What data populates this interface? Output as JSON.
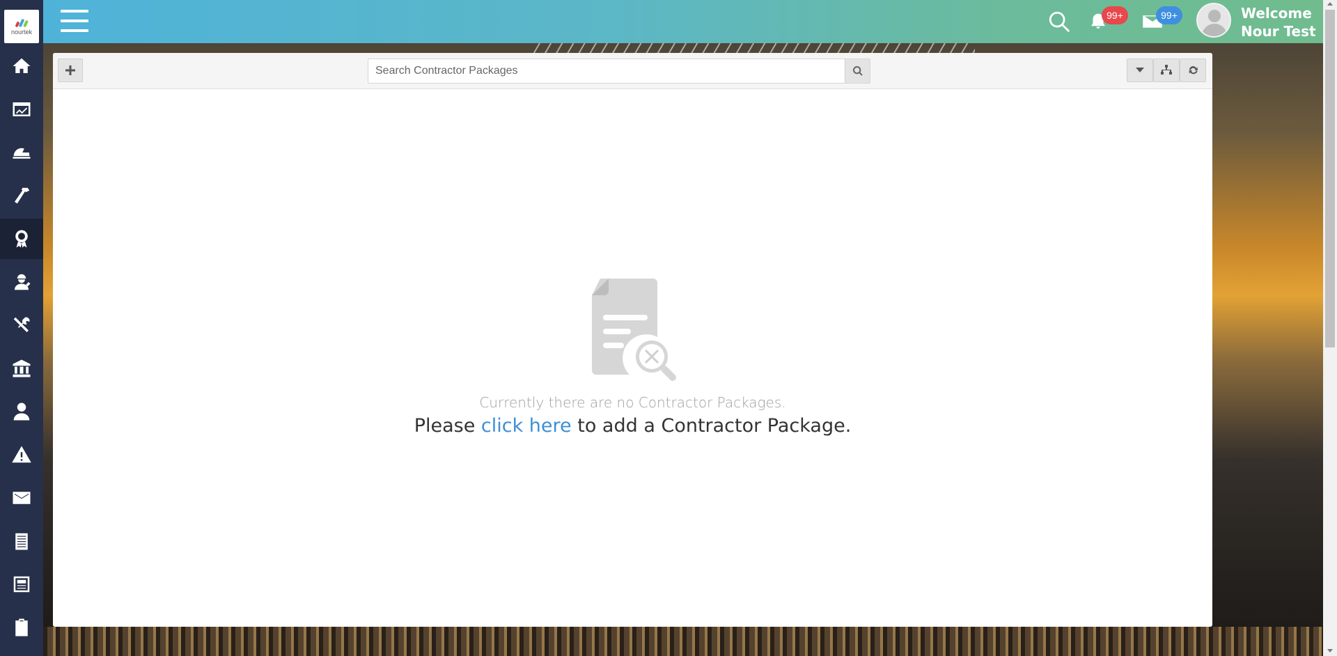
{
  "app": {
    "logo_text": "nourtek"
  },
  "sidebar": {
    "items": [
      {
        "name": "home-icon"
      },
      {
        "name": "dashboard-icon"
      },
      {
        "name": "helmet-icon"
      },
      {
        "name": "hammer-icon"
      },
      {
        "name": "award-icon",
        "active": true
      },
      {
        "name": "worker-icon"
      },
      {
        "name": "tools-icon"
      },
      {
        "name": "bank-icon"
      },
      {
        "name": "user-icon"
      },
      {
        "name": "warning-icon"
      },
      {
        "name": "mail-icon"
      },
      {
        "name": "notepad-icon"
      },
      {
        "name": "newspaper-icon"
      },
      {
        "name": "clipboard-icon"
      }
    ]
  },
  "header": {
    "notifications_badge": "99+",
    "messages_badge": "99+",
    "welcome_line1": "Welcome",
    "welcome_line2": "Nour Test"
  },
  "toolbar": {
    "search_placeholder": "Search Contractor Packages"
  },
  "empty_state": {
    "message": "Currently there are no Contractor Packages.",
    "cta_prefix": "Please ",
    "cta_link": "click here",
    "cta_suffix": " to add a Contractor Package."
  },
  "colors": {
    "sidebar_bg": "#26304a",
    "header_gradient_start": "#4fb3d9",
    "header_gradient_end": "#70bc8e",
    "badge_red": "#e8474b",
    "badge_blue": "#3f8fe0",
    "link": "#3d8fd6"
  }
}
